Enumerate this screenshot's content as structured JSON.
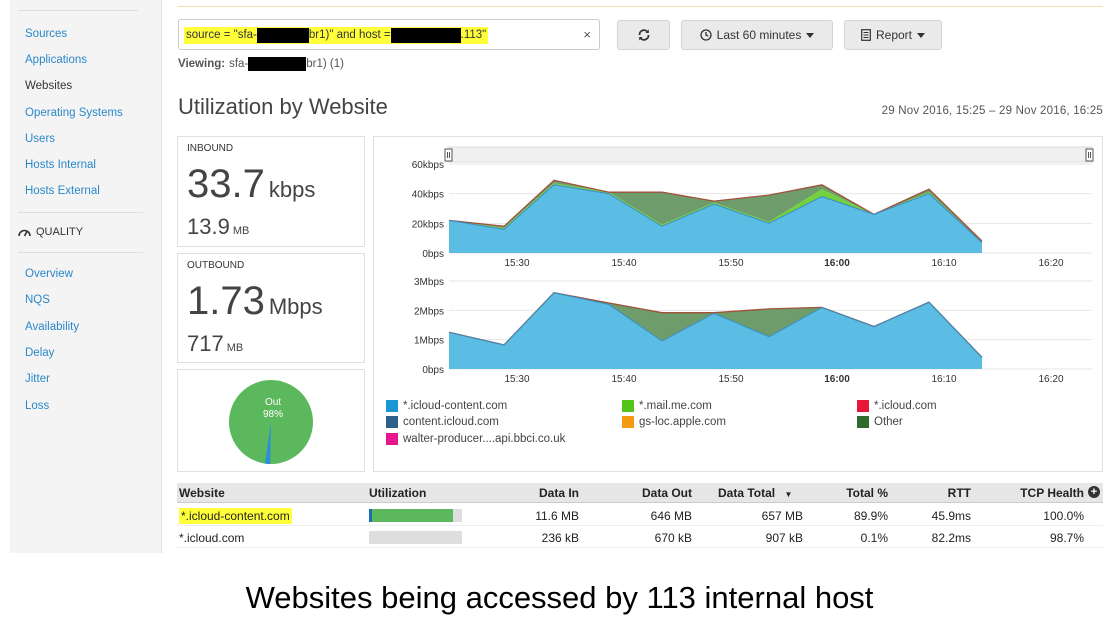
{
  "sidebar": {
    "items": [
      {
        "label": "Sources",
        "active": false
      },
      {
        "label": "Applications",
        "active": false
      },
      {
        "label": "Websites",
        "active": true
      },
      {
        "label": "Operating Systems",
        "active": false
      },
      {
        "label": "Users",
        "active": false
      },
      {
        "label": "Hosts Internal",
        "active": false
      },
      {
        "label": "Hosts External",
        "active": false
      }
    ],
    "section_label": "QUALITY",
    "quality_items": [
      "Overview",
      "NQS",
      "Availability",
      "Delay",
      "Jitter",
      "Loss"
    ]
  },
  "query": {
    "part1": "source = \"sfa-",
    "part2": "br1)\" and host = ",
    "part3": ".113\"",
    "clear_icon": "×"
  },
  "toolbar": {
    "time_label": "Last 60 minutes",
    "report_label": "Report"
  },
  "viewing": {
    "label": "Viewing:",
    "prefix": "sfa-",
    "suffix": "br1) (1)"
  },
  "page": {
    "title": "Utilization by Website",
    "daterange": "29 Nov 2016, 15:25 – 29 Nov 2016, 16:25"
  },
  "inbound": {
    "label": "INBOUND",
    "rate": "33.7",
    "rate_unit": "kbps",
    "total": "13.9",
    "total_unit": "MB"
  },
  "outbound": {
    "label": "OUTBOUND",
    "rate": "1.73",
    "rate_unit": "Mbps",
    "total": "717",
    "total_unit": "MB"
  },
  "pie": {
    "label": "Out",
    "pct_label": "98%",
    "out_fraction": 0.98
  },
  "chart_data": [
    {
      "type": "area",
      "ylim": [
        0,
        60
      ],
      "yticks": [
        "60kbps",
        "40kbps",
        "20kbps",
        "0bps"
      ],
      "xticks": [
        "15:30",
        "15:40",
        "15:50",
        "16:00",
        "16:10",
        "16:20"
      ],
      "x": [
        "15:25",
        "15:28",
        "15:32",
        "15:36",
        "15:39",
        "15:42",
        "15:46",
        "15:49",
        "15:52",
        "15:55",
        "15:58",
        "16:01",
        "16:04",
        "16:07",
        "16:10",
        "16:13",
        "16:16",
        "16:19",
        "16:22",
        "16:25"
      ],
      "series": [
        {
          "name": "*.icloud-content.com",
          "color": "#5bbce4",
          "values": [
            22,
            16,
            46,
            40,
            18,
            33,
            20,
            38,
            26,
            40,
            7
          ]
        },
        {
          "name": "*.mail.me.com",
          "color": "#73d13d",
          "values": [
            0,
            1,
            1,
            1,
            1,
            1,
            1,
            5,
            0,
            1,
            0
          ]
        },
        {
          "name": "Other",
          "color": "#6e9c6a",
          "values": [
            0,
            1,
            2,
            0,
            22,
            1,
            18,
            3,
            0,
            2,
            1
          ]
        }
      ]
    },
    {
      "type": "area",
      "ylim": [
        0,
        3
      ],
      "yticks": [
        "3Mbps",
        "2Mbps",
        "1Mbps",
        "0bps"
      ],
      "xticks": [
        "15:30",
        "15:40",
        "15:50",
        "16:00",
        "16:10",
        "16:20"
      ],
      "series": [
        {
          "name": "*.icloud-content.com",
          "color": "#5bbce4",
          "values": [
            1.25,
            0.82,
            2.6,
            2.2,
            0.95,
            1.9,
            1.1,
            2.1,
            1.45,
            2.28,
            0.4
          ]
        },
        {
          "name": "Other",
          "color": "#6e9c6a",
          "values": [
            0,
            0,
            0,
            0.05,
            0.97,
            0.02,
            0.95,
            0,
            0,
            0,
            0
          ]
        }
      ]
    }
  ],
  "legend": [
    {
      "name": "*.icloud-content.com",
      "color": "#1a96d4"
    },
    {
      "name": "*.mail.me.com",
      "color": "#52c41a"
    },
    {
      "name": "*.icloud.com",
      "color": "#e8173a"
    },
    {
      "name": "content.icloud.com",
      "color": "#2e5f8a"
    },
    {
      "name": "gs-loc.apple.com",
      "color": "#f39c12"
    },
    {
      "name": "Other",
      "color": "#2f6b2f"
    },
    {
      "name": "walter-producer....api.bbci.co.uk",
      "color": "#e8168c"
    }
  ],
  "table": {
    "headers": [
      "Website",
      "Utilization",
      "Data In",
      "Data Out",
      "Data Total",
      "Total %",
      "RTT",
      "TCP Health"
    ],
    "sort_icon": "▼",
    "add_icon": "+",
    "rows": [
      {
        "website": "*.icloud-content.com",
        "util": 0.9,
        "data_in": "11.6 MB",
        "data_out": "646 MB",
        "data_total": "657 MB",
        "total_pct": "89.9%",
        "rtt": "45.9ms",
        "tcp": "100.0%"
      },
      {
        "website": "*.icloud.com",
        "util": 0.0,
        "data_in": "236 kB",
        "data_out": "670 kB",
        "data_total": "907 kB",
        "total_pct": "0.1%",
        "rtt": "82.2ms",
        "tcp": "98.7%"
      }
    ]
  },
  "caption": "Websites being accessed by 113 internal host"
}
